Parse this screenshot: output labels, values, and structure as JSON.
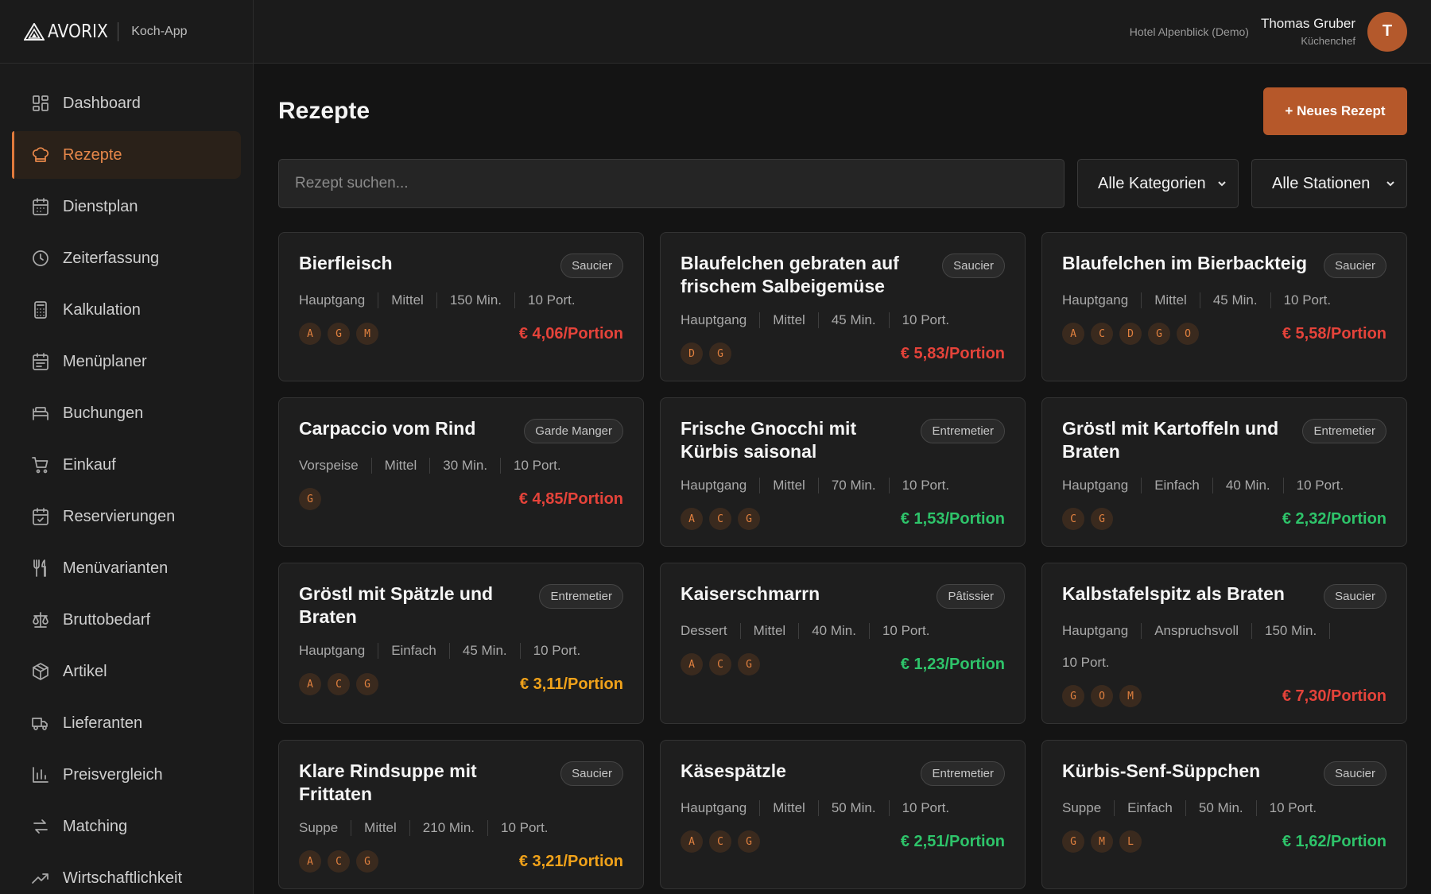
{
  "header": {
    "logo_text": "AVORIX",
    "app_name": "Koch-App",
    "hotel": "Hotel Alpenblick (Demo)",
    "user_name": "Thomas Gruber",
    "user_role": "Küchenchef",
    "avatar_initial": "T"
  },
  "sidebar": {
    "items": [
      {
        "label": "Dashboard",
        "icon": "dashboard-icon"
      },
      {
        "label": "Rezepte",
        "icon": "chef-hat-icon",
        "active": true
      },
      {
        "label": "Dienstplan",
        "icon": "calendar-icon"
      },
      {
        "label": "Zeiterfassung",
        "icon": "clock-icon"
      },
      {
        "label": "Kalkulation",
        "icon": "calculator-icon"
      },
      {
        "label": "Menüplaner",
        "icon": "calendar-list-icon"
      },
      {
        "label": "Buchungen",
        "icon": "bed-icon"
      },
      {
        "label": "Einkauf",
        "icon": "cart-icon"
      },
      {
        "label": "Reservierungen",
        "icon": "calendar-check-icon"
      },
      {
        "label": "Menüvarianten",
        "icon": "utensils-icon"
      },
      {
        "label": "Bruttobedarf",
        "icon": "scale-icon"
      },
      {
        "label": "Artikel",
        "icon": "package-icon"
      },
      {
        "label": "Lieferanten",
        "icon": "truck-icon"
      },
      {
        "label": "Preisvergleich",
        "icon": "bar-chart-icon"
      },
      {
        "label": "Matching",
        "icon": "arrows-icon"
      },
      {
        "label": "Wirtschaftlichkeit",
        "icon": "trend-icon"
      }
    ]
  },
  "main": {
    "title": "Rezepte",
    "new_button": "+ Neues Rezept",
    "search_placeholder": "Rezept suchen...",
    "category_select": "Alle Kategorien",
    "station_select": "Alle Stationen"
  },
  "recipes": [
    {
      "title": "Bierfleisch",
      "station": "Saucier",
      "meta": [
        "Hauptgang",
        "Mittel",
        "150 Min.",
        "10 Port."
      ],
      "allergens": [
        "A",
        "G",
        "M"
      ],
      "price": "€ 4,06/Portion",
      "price_color": "#e5433a"
    },
    {
      "title": "Blaufelchen gebraten auf frischem Salbeigemüse",
      "station": "Saucier",
      "meta": [
        "Hauptgang",
        "Mittel",
        "45 Min.",
        "10 Port."
      ],
      "allergens": [
        "D",
        "G"
      ],
      "price": "€ 5,83/Portion",
      "price_color": "#e5433a"
    },
    {
      "title": "Blaufelchen im Bierbackteig",
      "station": "Saucier",
      "meta": [
        "Hauptgang",
        "Mittel",
        "45 Min.",
        "10 Port."
      ],
      "allergens": [
        "A",
        "C",
        "D",
        "G",
        "O"
      ],
      "price": "€ 5,58/Portion",
      "price_color": "#e5433a"
    },
    {
      "title": "Carpaccio vom Rind",
      "station": "Garde Manger",
      "meta": [
        "Vorspeise",
        "Mittel",
        "30 Min.",
        "10 Port."
      ],
      "allergens": [
        "G"
      ],
      "price": "€ 4,85/Portion",
      "price_color": "#e5433a"
    },
    {
      "title": "Frische Gnocchi mit Kürbis saisonal",
      "station": "Entremetier",
      "meta": [
        "Hauptgang",
        "Mittel",
        "70 Min.",
        "10 Port."
      ],
      "allergens": [
        "A",
        "C",
        "G"
      ],
      "price": "€ 1,53/Portion",
      "price_color": "#2ec46a"
    },
    {
      "title": "Gröstl mit Kartoffeln und Braten",
      "station": "Entremetier",
      "meta": [
        "Hauptgang",
        "Einfach",
        "40 Min.",
        "10 Port."
      ],
      "allergens": [
        "C",
        "G"
      ],
      "price": "€ 2,32/Portion",
      "price_color": "#2ec46a"
    },
    {
      "title": "Gröstl mit Spätzle und Braten",
      "station": "Entremetier",
      "meta": [
        "Hauptgang",
        "Einfach",
        "45 Min.",
        "10 Port."
      ],
      "allergens": [
        "A",
        "C",
        "G"
      ],
      "price": "€ 3,11/Portion",
      "price_color": "#f0a21a"
    },
    {
      "title": "Kaiserschmarrn",
      "station": "Pâtissier",
      "meta": [
        "Dessert",
        "Mittel",
        "40 Min.",
        "10 Port."
      ],
      "allergens": [
        "A",
        "C",
        "G"
      ],
      "price": "€ 1,23/Portion",
      "price_color": "#2ec46a"
    },
    {
      "title": "Kalbstafelspitz als Braten",
      "station": "Saucier",
      "meta": [
        "Hauptgang",
        "Anspruchsvoll",
        "150 Min.",
        "10 Port."
      ],
      "allergens": [
        "G",
        "O",
        "M"
      ],
      "price": "€ 7,30/Portion",
      "price_color": "#e5433a"
    },
    {
      "title": "Klare Rindsuppe mit Frittaten",
      "station": "Saucier",
      "meta": [
        "Suppe",
        "Mittel",
        "210 Min.",
        "10 Port."
      ],
      "allergens": [
        "A",
        "C",
        "G"
      ],
      "price": "€ 3,21/Portion",
      "price_color": "#f0a21a"
    },
    {
      "title": "Käsespätzle",
      "station": "Entremetier",
      "meta": [
        "Hauptgang",
        "Mittel",
        "50 Min.",
        "10 Port."
      ],
      "allergens": [
        "A",
        "C",
        "G"
      ],
      "price": "€ 2,51/Portion",
      "price_color": "#2ec46a"
    },
    {
      "title": "Kürbis-Senf-Süppchen",
      "station": "Saucier",
      "meta": [
        "Suppe",
        "Einfach",
        "50 Min.",
        "10 Port."
      ],
      "allergens": [
        "G",
        "M",
        "L"
      ],
      "price": "€ 1,62/Portion",
      "price_color": "#2ec46a"
    }
  ]
}
